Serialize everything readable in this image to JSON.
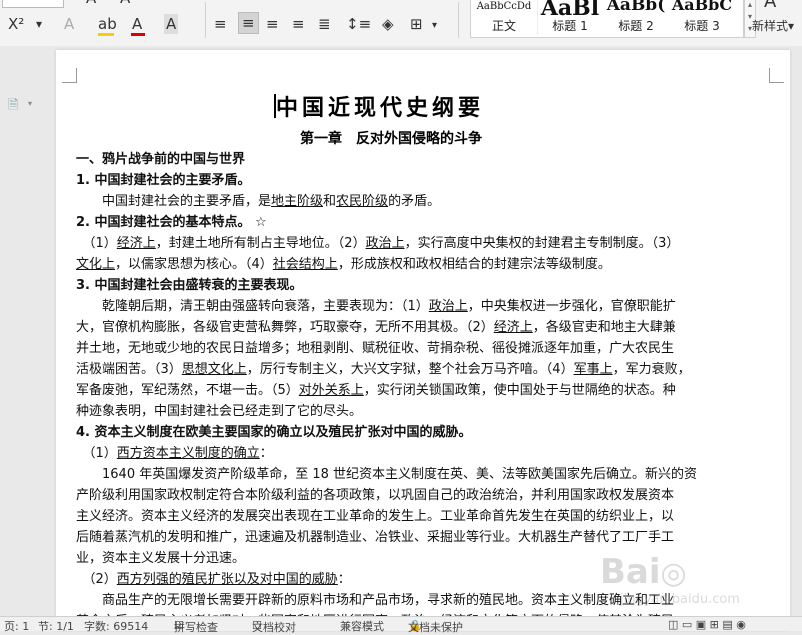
{
  "ribbon": {
    "styles": [
      {
        "preview": "AaBbCcDd",
        "name": "正文",
        "size": 10
      },
      {
        "preview": "AaBl",
        "name": "标题 1",
        "size": 22
      },
      {
        "preview": "AaBb(",
        "name": "标题 2",
        "size": 18
      },
      {
        "preview": "AaBbC",
        "name": "标题 3",
        "size": 17
      }
    ],
    "new_style": "新样式",
    "icons": [
      "superscript-icon",
      "subscript-icon",
      "clear-format-icon",
      "highlight-icon",
      "font-color-icon",
      "char-shading-icon",
      "align-left-icon",
      "align-center-icon",
      "align-right-icon",
      "justify-icon",
      "distributed-icon",
      "line-spacing-icon",
      "shading-icon",
      "borders-icon"
    ]
  },
  "doc": {
    "title": "中国近现代史纲要",
    "chapter": "第一章　反对外国侵略的斗争",
    "lines": [
      {
        "cls": "h",
        "segs": [
          {
            "t": "一、鸦片战争前的中国与世界"
          }
        ]
      },
      {
        "cls": "h",
        "segs": [
          {
            "t": "1.  中国封建社会的主要矛盾。"
          }
        ]
      },
      {
        "cls": "",
        "segs": [
          {
            "t": "　　中国封建社会的主要矛盾，是"
          },
          {
            "t": "地主阶级",
            "u": 1
          },
          {
            "t": "和"
          },
          {
            "t": "农民阶级",
            "u": 1
          },
          {
            "t": "的矛盾。"
          }
        ]
      },
      {
        "cls": "h",
        "segs": [
          {
            "t": "2.  中国封建社会的基本特点。 ☆"
          }
        ]
      },
      {
        "cls": "",
        "segs": [
          {
            "t": "　（1）"
          },
          {
            "t": "经济上",
            "u": 1
          },
          {
            "t": "，封建土地所有制占主导地位。（2）"
          },
          {
            "t": "政治上",
            "u": 1
          },
          {
            "t": "，实行高度中央集权的封建君主专制制度。（3）"
          }
        ]
      },
      {
        "cls": "",
        "segs": [
          {
            "t": "文化上",
            "u": 1
          },
          {
            "t": "，以儒家思想为核心。（4）"
          },
          {
            "t": "社会结构上",
            "u": 1
          },
          {
            "t": "，形成族权和政权相结合的封建宗法等级制度。"
          }
        ]
      },
      {
        "cls": "h",
        "segs": [
          {
            "t": "3.  中国封建社会由盛转衰的主要表现。"
          }
        ]
      },
      {
        "cls": "",
        "segs": [
          {
            "t": "　　乾隆朝后期，清王朝由强盛转向衰落，主要表现为：（1）"
          },
          {
            "t": "政治上",
            "u": 1
          },
          {
            "t": "，中央集权进一步强化，官僚职能扩"
          }
        ]
      },
      {
        "cls": "",
        "segs": [
          {
            "t": "大，官僚机构膨胀，各级官吏营私舞弊，巧取豪夺，无所不用其极。（2）"
          },
          {
            "t": "经济上",
            "u": 1
          },
          {
            "t": "，各级官吏和地主大肆兼"
          }
        ]
      },
      {
        "cls": "",
        "segs": [
          {
            "t": "并土地，无地或少地的农民日益增多；地租剥削、赋税征收、苛捐杂税、徭役摊派逐年加重，广大农民生"
          }
        ]
      },
      {
        "cls": "",
        "segs": [
          {
            "t": "活极端困苦。（3）"
          },
          {
            "t": "思想文化上",
            "u": 1
          },
          {
            "t": "，厉行专制主义，大兴文字狱，整个社会万马齐喑。（4）"
          },
          {
            "t": "军事上",
            "u": 1
          },
          {
            "t": "，军力衰败，"
          }
        ]
      },
      {
        "cls": "",
        "segs": [
          {
            "t": "军备废弛，军纪荡然，不堪一击。（5）"
          },
          {
            "t": "对外关系上",
            "u": 1
          },
          {
            "t": "，实行闭关锁国政策，使中国处于与世隔绝的状态。种"
          }
        ]
      },
      {
        "cls": "",
        "segs": [
          {
            "t": "种迹象表明，中国封建社会已经走到了它的尽头。"
          }
        ]
      },
      {
        "cls": "h",
        "segs": [
          {
            "t": "4.  资本主义制度在欧美主要国家的确立以及殖民扩张对中国的威胁。"
          }
        ]
      },
      {
        "cls": "",
        "segs": [
          {
            "t": "　（1）"
          },
          {
            "t": "西方资本主义制度的确立",
            "u": 1
          },
          {
            "t": "："
          }
        ]
      },
      {
        "cls": "",
        "segs": [
          {
            "t": "　　1640 年英国爆发资产阶级革命，至 18 世纪资本主义制度在英、美、法等欧美国家先后确立。新兴的资"
          }
        ]
      },
      {
        "cls": "",
        "segs": [
          {
            "t": "产阶级利用国家政权制定符合本阶级利益的各项政策，以巩固自己的政治统治，并利用国家政权发展资本"
          }
        ]
      },
      {
        "cls": "",
        "segs": [
          {
            "t": "主义经济。资本主义经济的发展突出表现在工业革命的发生上。工业革命首先发生在英国的纺织业上，以"
          }
        ]
      },
      {
        "cls": "",
        "segs": [
          {
            "t": "后随着蒸汽机的发明和推广，迅速遍及机器制造业、冶铁业、采掘业等行业。大机器生产替代了工厂手工"
          }
        ]
      },
      {
        "cls": "",
        "segs": [
          {
            "t": "业，资本主义发展十分迅速。"
          }
        ]
      },
      {
        "cls": "",
        "segs": [
          {
            "t": "　（2）"
          },
          {
            "t": "西方列强的殖民扩张以及对中国的威胁",
            "u": 1
          },
          {
            "t": "："
          }
        ]
      },
      {
        "cls": "",
        "segs": [
          {
            "t": "　　商品生产的无限增长需要开辟新的原料市场和产品市场，寻求新的殖民地。资本主义制度确立和工业"
          }
        ]
      },
      {
        "cls": "",
        "segs": [
          {
            "t": "革命之后，殖民主义者加紧对一些国家和地区进行军事、政治、经济和文化等方面的侵略，使其沦为殖民"
          }
        ]
      }
    ]
  },
  "status": {
    "page": "页: 1",
    "section": "节: 1/1",
    "words": "字数: 69514",
    "spell": "拼写检查",
    "doc_check": "文档校对",
    "compat": "兼容模式",
    "unprotected": "文档未保护"
  },
  "watermark": {
    "main": "Bai",
    "sub": "jingyan.baidu.com"
  }
}
